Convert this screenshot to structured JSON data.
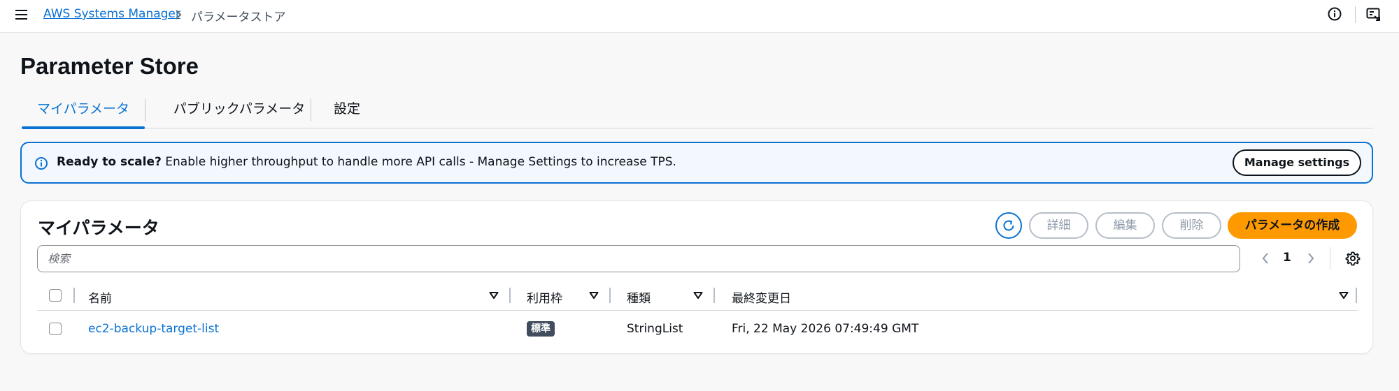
{
  "topbar": {
    "service_link": "AWS Systems Manager",
    "current_page": "パラメータストア"
  },
  "page": {
    "title": "Parameter Store"
  },
  "tabs": [
    {
      "label": "マイパラメータ",
      "active": true
    },
    {
      "label": "パブリックパラメータ",
      "active": false
    },
    {
      "label": "設定",
      "active": false
    }
  ],
  "alert": {
    "bold_text": "Ready to scale?",
    "text": " Enable higher throughput to handle more API calls - Manage Settings to increase TPS.",
    "button_label": "Manage settings"
  },
  "table_panel": {
    "title": "マイパラメータ",
    "details_button": "詳細",
    "edit_button": "編集",
    "delete_button": "削除",
    "create_button": "パラメータの作成",
    "search_placeholder": "検索",
    "current_page": "1",
    "columns": [
      "名前",
      "利用枠",
      "種類",
      "最終変更日"
    ],
    "rows": [
      {
        "name": "ec2-backup-target-list",
        "tier": "標準",
        "type": "StringList",
        "last_modified": "Fri, 22 May 2026 07:49:49 GMT"
      }
    ]
  },
  "colors": {
    "accent": "#0972d3",
    "primary_button": "#ff9900",
    "alert_background": "#f2f8fd",
    "badge": "#414d5c"
  },
  "icons": [
    "menu-icon",
    "chevron-right-icon",
    "info-icon",
    "screen-icon",
    "refresh-icon",
    "chevron-left-icon",
    "settings-gear-icon",
    "sort-caret-icon"
  ]
}
